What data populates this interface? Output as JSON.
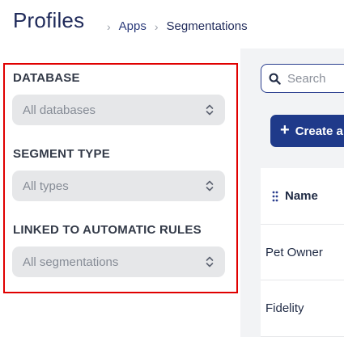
{
  "header": {
    "title": "Profiles",
    "breadcrumb": [
      "Apps",
      "Segmentations"
    ]
  },
  "filters": {
    "database": {
      "label": "DATABASE",
      "value": "All databases"
    },
    "segment_type": {
      "label": "SEGMENT TYPE",
      "value": "All types"
    },
    "linked_rules": {
      "label": "LINKED TO AUTOMATIC RULES",
      "value": "All segmentations"
    }
  },
  "search": {
    "placeholder": "Search",
    "icon": "search-icon"
  },
  "create_button": {
    "label": "Create a",
    "icon": "plus-icon"
  },
  "table": {
    "columns": [
      "Name"
    ],
    "rows": [
      {
        "name": "Pet Owner"
      },
      {
        "name": "Fidelity"
      }
    ]
  },
  "colors": {
    "accent": "#1f3a8a",
    "highlight_border": "#e00000",
    "select_bg": "#e6e7e9"
  }
}
